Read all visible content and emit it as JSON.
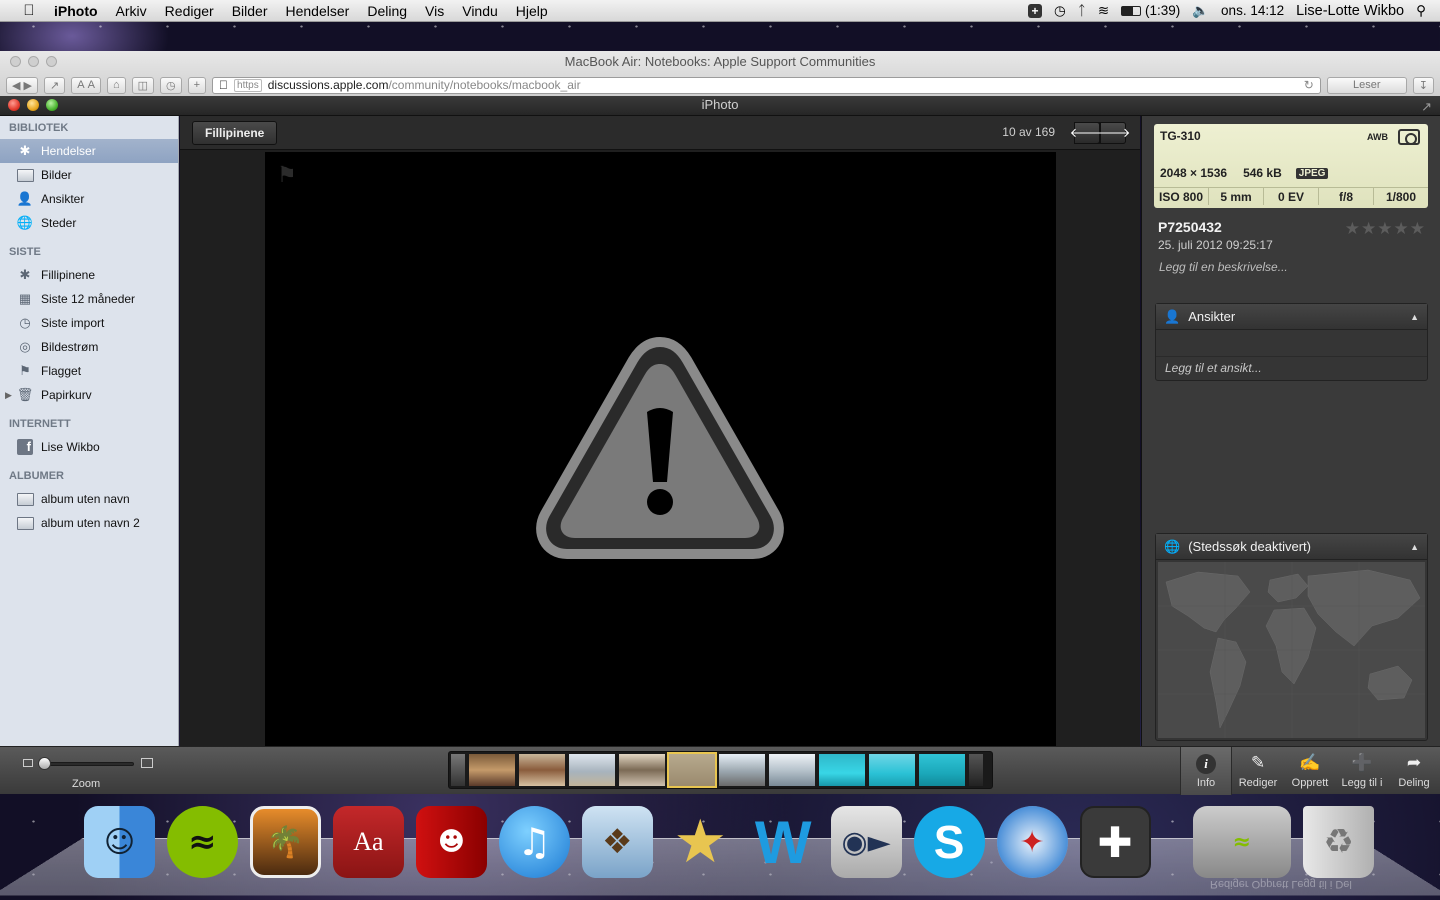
{
  "menubar": {
    "apple": "",
    "items": [
      "iPhoto",
      "Arkiv",
      "Rediger",
      "Bilder",
      "Hendelser",
      "Deling",
      "Vis",
      "Vindu",
      "Hjelp"
    ],
    "battery": "(1:39)",
    "clock": "ons. 14:12",
    "user": "Lise-Lotte Wikbo"
  },
  "safari": {
    "title": "MacBook Air: Notebooks: Apple Support Communities",
    "url_scheme": "https",
    "url_host": "discussions.apple.com",
    "url_path": "/community/notebooks/macbook_air",
    "reader": "Leser"
  },
  "window": {
    "title": "iPhoto"
  },
  "sidebar": {
    "library_header": "BIBLIOTEK",
    "library": [
      "Hendelser",
      "Bilder",
      "Ansikter",
      "Steder"
    ],
    "recent_header": "SISTE",
    "recent": [
      "Fillipinene",
      "Siste 12 måneder",
      "Siste import",
      "Bildestrøm",
      "Flagget",
      "Papirkurv"
    ],
    "internet_header": "INTERNETT",
    "internet": [
      "Lise Wikbo"
    ],
    "albums_header": "ALBUMER",
    "albums": [
      "album uten navn",
      "album uten navn 2"
    ]
  },
  "viewer": {
    "breadcrumb": "Fillipinene",
    "counter": "10 av 169",
    "prev": "🡐",
    "next": "🡒"
  },
  "info": {
    "camera": "TG-310",
    "awb": "AWB",
    "dimensions": "2048 × 1536",
    "size": "546 kB",
    "format": "JPEG",
    "iso": "ISO 800",
    "focal": "5 mm",
    "ev": "0 EV",
    "aperture": "f/8",
    "shutter": "1/800",
    "name": "P7250432",
    "date": "25. juli 2012 09:25:17",
    "description_placeholder": "Legg til en beskrivelse...",
    "rating_stars": "★★★★★",
    "faces_title": "Ansikter",
    "faces_add": "Legg til et ansikt...",
    "places_title": "(Stedssøk deaktivert)"
  },
  "bottombar": {
    "zoom_label": "Zoom",
    "zoom_level": 0.0,
    "tools": [
      "Info",
      "Rediger",
      "Opprett",
      "Legg til i",
      "Deling"
    ]
  },
  "colors": {
    "sidebar_bg": "#dde3ec",
    "selection": "#8ea3c2",
    "viewer_bg": "#1f1f1f",
    "exif_bg": "#e6e8c6"
  },
  "dock": {
    "apps": [
      "finder-icon",
      "spotify-icon",
      "iphoto-icon",
      "dictionary-icon",
      "photo-booth-icon",
      "itunes-icon",
      "mail-icon",
      "imovie-icon",
      "word-icon",
      "facetime-icon",
      "skype-icon",
      "safari-icon",
      "app-store-icon",
      "downloads-icon",
      "trash-icon"
    ],
    "dictionary_label": "Aa",
    "reflection": "Rediger  Opprett  Legg til i  Del"
  }
}
